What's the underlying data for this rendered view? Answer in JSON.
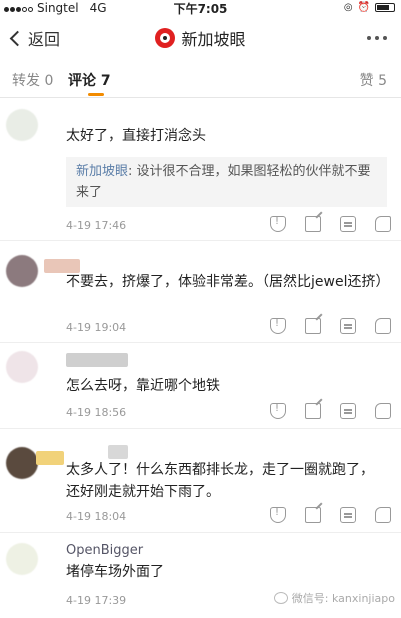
{
  "status": {
    "carrier": "Singtel",
    "network": "4G",
    "time": "下午7:05"
  },
  "nav": {
    "back_label": "返回",
    "title": "新加坡眼"
  },
  "tabs": {
    "repost": "转发 0",
    "comment": "评论 7",
    "like": "赞 5"
  },
  "comments": [
    {
      "text": "太好了，直接打消念头",
      "reply_author": "新加坡眼",
      "reply_text": ": 设计很不合理，如果图轻松的伙伴就不要来了",
      "time": "4-19 17:46"
    },
    {
      "text": "不要去，挤爆了，体验非常差。（居然比jewel还挤）",
      "time": "4-19 19:04"
    },
    {
      "text": "怎么去呀，靠近哪个地铁",
      "time": "4-19 18:56"
    },
    {
      "text": "太多人了！什么东西都排长龙，走了一圈就跑了，还好刚走就开始下雨了。",
      "time": "4-19 18:04"
    },
    {
      "author": "OpenBigger",
      "text": "堵停车场外面了",
      "time": "4-19 17:39"
    }
  ],
  "watermark": "微信号: kanxinjiapo"
}
